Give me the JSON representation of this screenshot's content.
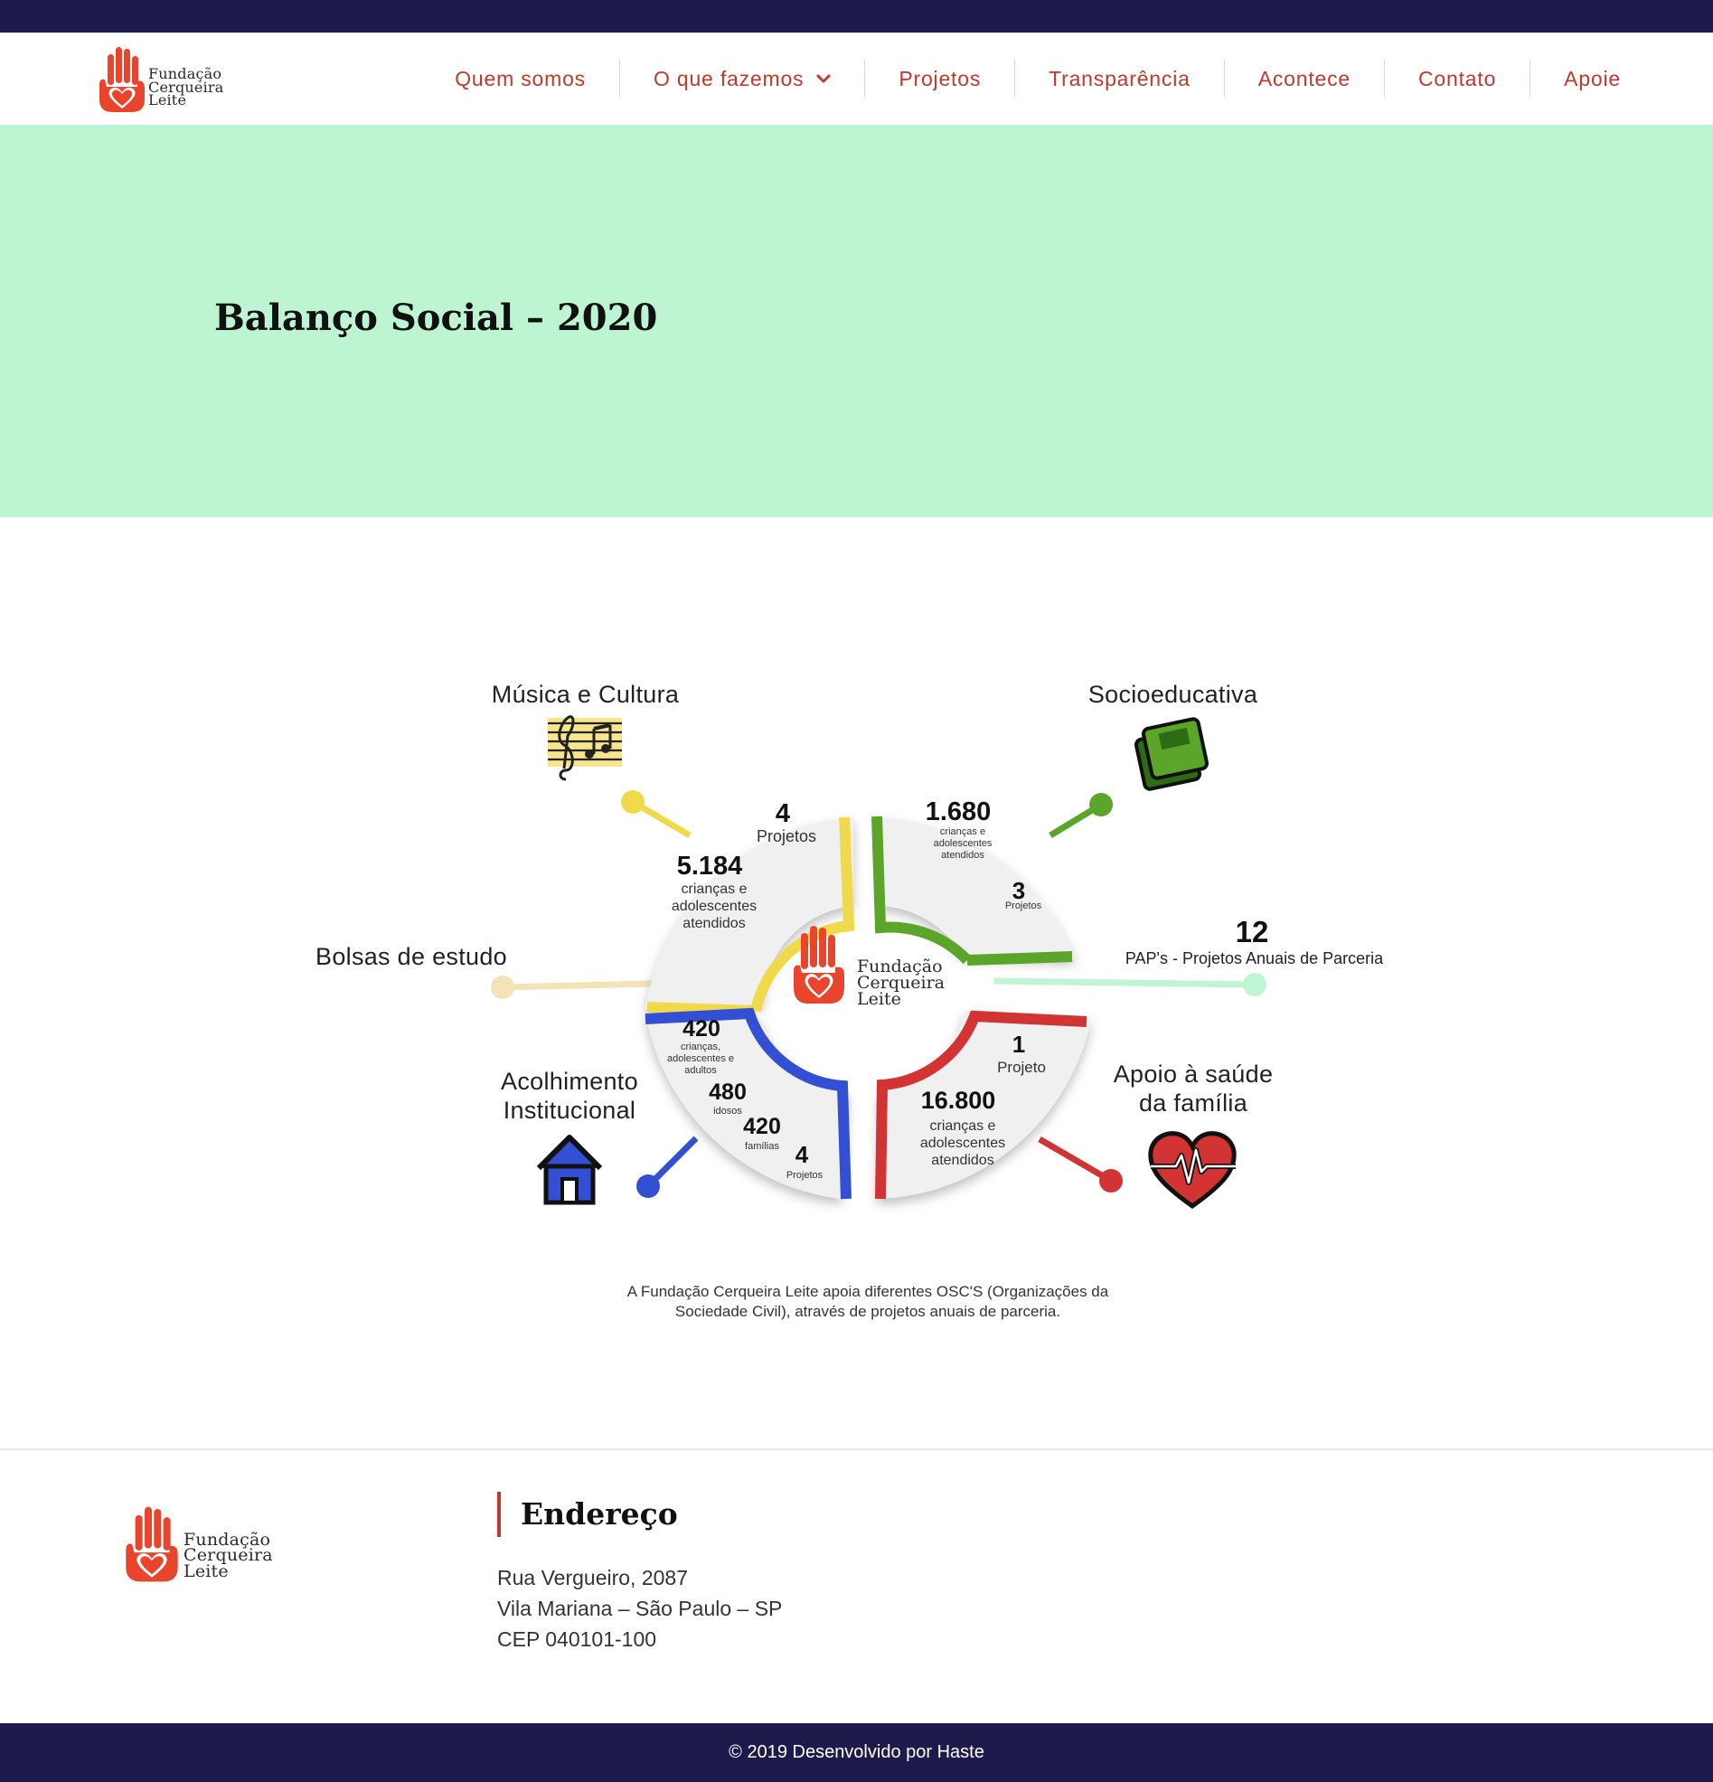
{
  "header": {
    "logo": {
      "line1": "Fundação",
      "line2": "Cerqueira",
      "line3": "Leite"
    },
    "nav": [
      {
        "label": "Quem somos"
      },
      {
        "label": "O que fazemos"
      },
      {
        "label": "Projetos"
      },
      {
        "label": "Transparência"
      },
      {
        "label": "Acontece"
      },
      {
        "label": "Contato"
      },
      {
        "label": "Apoie"
      }
    ]
  },
  "hero": {
    "title": "Balanço Social – 2020"
  },
  "infographic": {
    "musica": {
      "title": "Música e Cultura",
      "projects_num": "4",
      "projects_label": "Projetos",
      "people_num": "5.184",
      "people_label1": "crianças e",
      "people_label2": "adolescentes",
      "people_label3": "atendidos"
    },
    "socio": {
      "title": "Socioeducativa",
      "people_num": "1.680",
      "people_label1": "crianças e",
      "people_label2": "adolescentes",
      "people_label3": "atendidos",
      "projects_num": "3",
      "projects_label": "Projetos"
    },
    "bolsas": {
      "title": "Bolsas de estudo"
    },
    "paps": {
      "num": "12",
      "label": "PAP's - Projetos Anuais de Parceria"
    },
    "acolhimento": {
      "title1": "Acolhimento",
      "title2": "Institucional",
      "n1": "420",
      "l1a": "crianças,",
      "l1b": "adolescentes e",
      "l1c": "adultos",
      "n2": "480",
      "l2": "idosos",
      "n3": "420",
      "l3": "famílias",
      "n4": "4",
      "l4": "Projetos"
    },
    "saude": {
      "title1": "Apoio à saúde",
      "title2": "da família",
      "projects_num": "1",
      "projects_label": "Projeto",
      "people_num": "16.800",
      "people_label1": "crianças e",
      "people_label2": "adolescentes",
      "people_label3": "atendidos"
    },
    "center_logo": {
      "line1": "Fundação",
      "line2": "Cerqueira",
      "line3": "Leite"
    },
    "caption1": "A Fundação Cerqueira Leite apoia diferentes OSC'S (Organizações da",
    "caption2": "Sociedade Civil), através de projetos anuais de parceria."
  },
  "footer": {
    "logo": {
      "line1": "Fundação",
      "line2": "Cerqueira",
      "line3": "Leite"
    },
    "address_title": "Endereço",
    "address_line1": "Rua Vergueiro, 2087",
    "address_line2": "Vila Mariana – São Paulo – SP",
    "address_line3": "CEP 040101-100",
    "copyright": "© 2019 Desenvolvido por Haste"
  },
  "colors": {
    "navy": "#1e1a4c",
    "mint": "#bdf4d2",
    "brand_red": "#c0392b",
    "logo_red": "#e8452c",
    "yellow": "#f0d94a",
    "green": "#5aa52a",
    "blue": "#3350d4",
    "red": "#d23434",
    "beige": "#f3e3b6",
    "light_green": "#bff5d2"
  }
}
